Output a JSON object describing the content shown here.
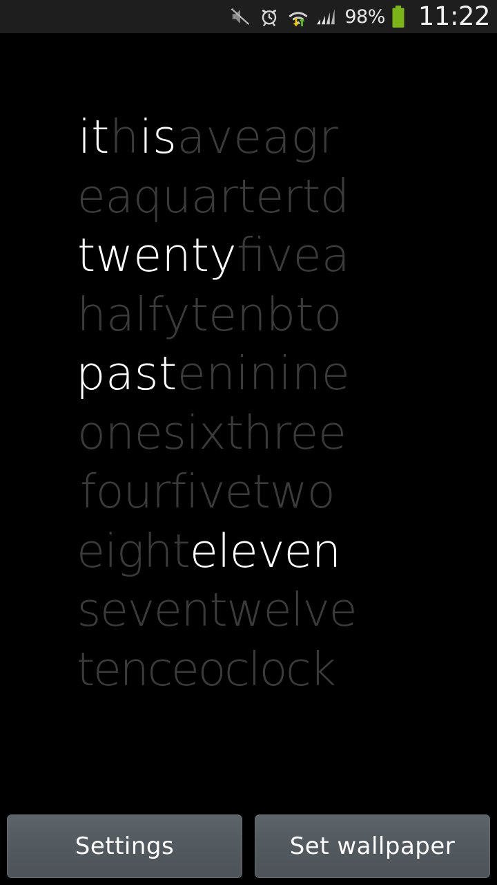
{
  "status_bar": {
    "background_color": "#1e1e1e",
    "icons": [
      {
        "name": "mute-icon",
        "label": "Silent mode"
      },
      {
        "name": "alarm-clock-icon",
        "label": "Alarm set"
      },
      {
        "name": "wifi-data-transfer-icon",
        "label": "Wi-Fi connected, data activity"
      },
      {
        "name": "cellular-signal-icon",
        "label": "Signal 4 bars"
      }
    ],
    "battery_percent": "98%",
    "battery_color": "#7cb518",
    "clock": "11:22"
  },
  "wallpaper": {
    "name": "word-clock-live-wallpaper",
    "background_color": "#000000",
    "active_color": "#ffffff",
    "inactive_color": "#3b3b3b",
    "reading": "it is twenty past eleven",
    "rows": [
      {
        "index": 0,
        "text": "ithisaveagr",
        "segments": [
          {
            "text": "it",
            "active": true
          },
          {
            "text": "h",
            "active": false
          },
          {
            "text": "is",
            "active": true
          },
          {
            "text": "aveagr",
            "active": false
          }
        ]
      },
      {
        "index": 1,
        "text": "eaquartertd",
        "segments": [
          {
            "text": "eaquartertd",
            "active": false
          }
        ]
      },
      {
        "index": 2,
        "text": "twentyfivea",
        "segments": [
          {
            "text": "twenty",
            "active": true
          },
          {
            "text": "fivea",
            "active": false
          }
        ]
      },
      {
        "index": 3,
        "text": "halfytenbto",
        "segments": [
          {
            "text": "halfytenbto",
            "active": false
          }
        ]
      },
      {
        "index": 4,
        "text": "pasteninine",
        "segments": [
          {
            "text": "past",
            "active": true
          },
          {
            "text": "eninine",
            "active": false
          }
        ]
      },
      {
        "index": 5,
        "text": "onesixthree",
        "segments": [
          {
            "text": "onesixthree",
            "active": false
          }
        ]
      },
      {
        "index": 6,
        "text": "fourfivetwo",
        "segments": [
          {
            "text": "fourfivetwo",
            "active": false
          }
        ]
      },
      {
        "index": 7,
        "text": "eighteleven",
        "segments": [
          {
            "text": "eight",
            "active": false
          },
          {
            "text": "eleven",
            "active": true
          }
        ]
      },
      {
        "index": 8,
        "text": "seventwelve",
        "segments": [
          {
            "text": "seventwelve",
            "active": false
          }
        ]
      },
      {
        "index": 9,
        "text": "tenceoclock",
        "segments": [
          {
            "text": "tenceoclock",
            "active": false
          }
        ]
      }
    ]
  },
  "buttons": {
    "settings_label": "Settings",
    "set_wallpaper_label": "Set wallpaper"
  }
}
